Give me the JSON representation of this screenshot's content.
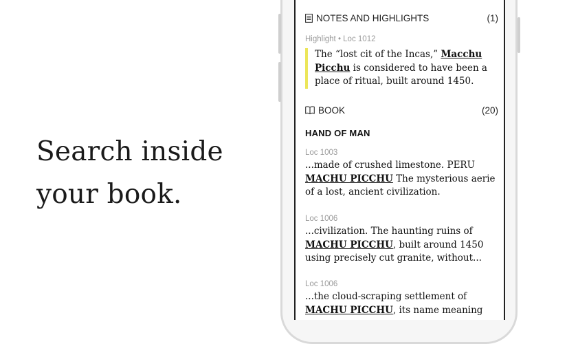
{
  "tagline": {
    "line1": "Search inside",
    "line2": "your book."
  },
  "notes_section": {
    "title": "NOTES AND HIGHLIGHTS",
    "count": "(1)"
  },
  "highlight": {
    "meta": "Highlight • Loc 1012",
    "pre": "The “lost cit of the Incas,” ",
    "match": "Macchu Picchu",
    "post": " is considered to have been a place of ritual, built around 1450."
  },
  "book_section": {
    "title": "BOOK",
    "count": "(20)"
  },
  "chapter": "HAND OF MAN",
  "results": [
    {
      "loc": "Loc 1003",
      "pre": "...made of crushed limestone.  PERU ",
      "match": "MACHU PICCHU",
      "post": "  The mysterious aerie of a lost, ancient civilization."
    },
    {
      "loc": "Loc 1006",
      "pre": "...civilization.  The haunting ruins of ",
      "match": "MACHU PICCHU",
      "post": ", built around 1450 using precisely cut granite, without..."
    },
    {
      "loc": "Loc 1006",
      "pre": "...the cloud-scraping settlement of ",
      "match": "MACHU PICCHU",
      "post": ", its name meaning"
    }
  ],
  "colors": {
    "highlight_bar": "#ece65a",
    "muted_text": "#9a9a9a"
  }
}
